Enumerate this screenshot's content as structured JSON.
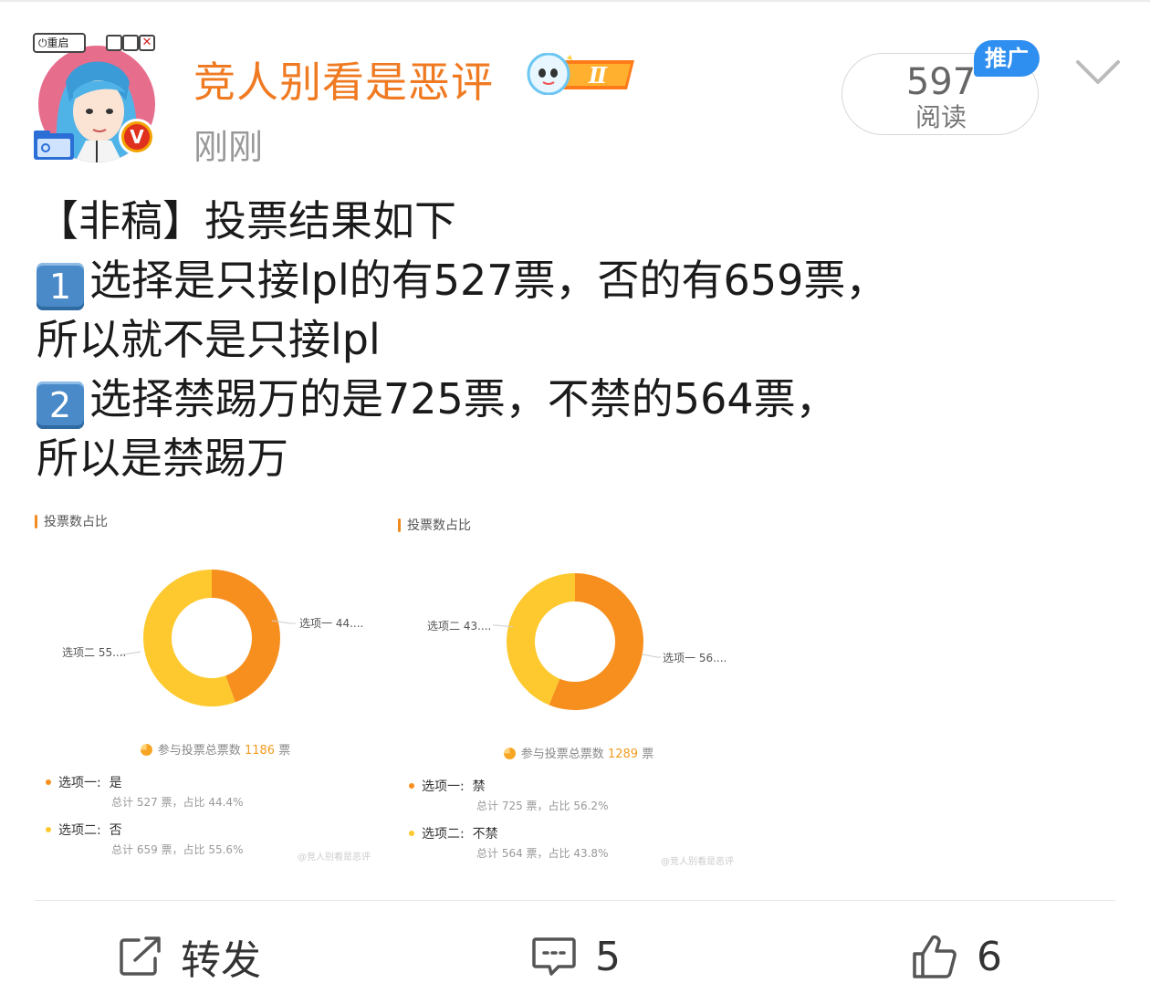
{
  "header": {
    "username": "竞人别看是恶评",
    "post_time": "刚刚",
    "level_badge": "Ⅱ",
    "read_count": "597",
    "read_label": "阅读",
    "promo_tag": "推广",
    "avatar_window": {
      "reboot_label": "⏻重启",
      "close_glyph": "✕"
    },
    "verified_badge": "V"
  },
  "post": {
    "lines": [
      "【非稿】投票结果如下",
      "选择是只接lpl的有527票，否的有659票，",
      "所以就不是只接lpl",
      "选择禁踢万的是725票，不禁的564票，",
      "所以是禁踢万"
    ],
    "keycap_1": "1",
    "keycap_2": "2"
  },
  "polls": [
    {
      "title": "投票数占比",
      "total_prefix": "参与投票总票数",
      "total_value": "1186",
      "total_suffix": "票",
      "label_a": "选项一 44....",
      "label_b": "选项二 55....",
      "options": [
        {
          "label": "选项一:",
          "value": "是",
          "detail": "总计 527 票，占比 44.4%",
          "color": "#f78f1e",
          "share": 0.444
        },
        {
          "label": "选项二:",
          "value": "否",
          "detail": "总计 659 票，占比 55.6%",
          "color": "#fdc92f",
          "share": 0.556
        }
      ],
      "watermark": "@竞人别看是恶评"
    },
    {
      "title": "投票数占比",
      "total_prefix": "参与投票总票数",
      "total_value": "1289",
      "total_suffix": "票",
      "label_a": "选项一 56....",
      "label_b": "选项二 43....",
      "options": [
        {
          "label": "选项一:",
          "value": "禁",
          "detail": "总计 725 票，占比 56.2%",
          "color": "#f78f1e",
          "share": 0.562
        },
        {
          "label": "选项二:",
          "value": "不禁",
          "detail": "总计 564 票，占比 43.8%",
          "color": "#fdc92f",
          "share": 0.438
        }
      ],
      "watermark": "@竞人别看是恶评"
    }
  ],
  "footer": {
    "repost_label": "转发",
    "comment_count": "5",
    "like_count": "6"
  },
  "icons": {
    "repost": "repost-icon",
    "comment": "comment-icon",
    "like": "thumbs-up-icon",
    "chevron": "chevron-down-icon"
  },
  "colors": {
    "username": "#f07a21",
    "promo": "#2f8ff0",
    "option_one": "#f78f1e",
    "option_two": "#fdc92f"
  }
}
